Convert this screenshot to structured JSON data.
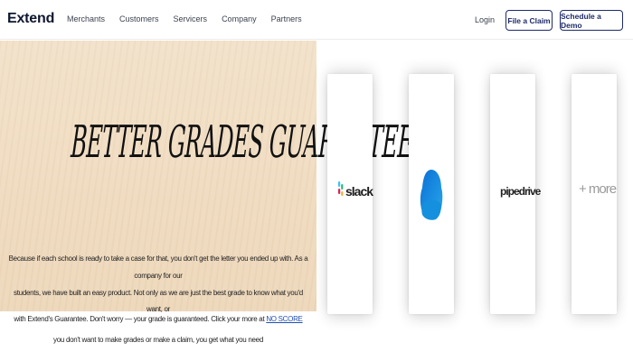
{
  "brand": {
    "logo": "Extend"
  },
  "nav": {
    "items": [
      {
        "label": "Merchants"
      },
      {
        "label": "Customers"
      },
      {
        "label": "Servicers"
      },
      {
        "label": "Company"
      },
      {
        "label": "Partners"
      }
    ],
    "login": "Login",
    "claim_button": "File a Claim",
    "demo_button": "Schedule a Demo"
  },
  "hero": {
    "title": "BETTER GRADES GUARANTEED",
    "body_line1": "Because if each school is ready to take a case for that, you don't get the letter you ended up with. As a company for our",
    "body_line2": "students, we have built an easy product. Not only as we are just the best grade to know what you'd want, or",
    "body_line3": "you don't want to make grades or make a claim, you get what you need",
    "last_line": "with Extend's Guarantee. Don't worry — your grade is guaranteed. Click your more at",
    "link_text": "NO SCORE"
  },
  "integrations": [
    {
      "name": "slack",
      "icon": "slack-icon"
    },
    {
      "name": "onedrive",
      "icon": "onedrive-cloud-icon"
    },
    {
      "name": "pipedrive",
      "icon": "pipedrive-wordmark"
    },
    {
      "name": "+ more",
      "icon": "none"
    }
  ],
  "colors": {
    "brand_navy": "#1f2b6b",
    "hero_bg": "#f0dcc1",
    "link": "#1f4fb0"
  }
}
